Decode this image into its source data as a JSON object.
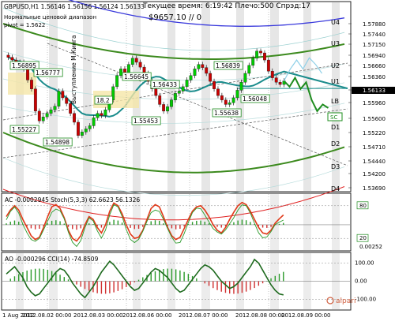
{
  "header": {
    "symbol_line": "GBPUSD,H1  1.56146 1.56156 1.56124 1.56133",
    "indicator_line1": "Нормальные ценовой диапазон",
    "indicator_line2": "pivot = 1.5622",
    "time_line": "Текущее время: 6:19:42  Плечо:500  Спрэд:17",
    "balance_line": "$9657.10   // 0"
  },
  "levels_left": [
    "U4",
    "U3",
    "U2",
    "U1",
    "LB",
    "D1",
    "D2",
    "D3",
    "D4"
  ],
  "price_axis_labels": [
    "1.57880",
    "1.57440",
    "1.57150",
    "1.56940",
    "1.56660",
    "1.56360",
    "1.56133",
    "1.55960",
    "1.55600",
    "1.55220",
    "1.54710",
    "1.54440",
    "1.54200",
    "1.53690"
  ],
  "price_tags": [
    "1.56895",
    "1.56777",
    "1.56645",
    "1.56433",
    "1.56839",
    "1.56048",
    "1.55453",
    "1.55638",
    "1.55227",
    "1.54898",
    "18.2"
  ],
  "vertical_label": "Выступление М.Кинга",
  "sc_label": "SC",
  "ac_panel": {
    "label": "AC -0.0002945  Stoch(5,3,3) 62.6623 56.1326",
    "axis": [
      "80",
      "20",
      "0.00252"
    ]
  },
  "ao_panel": {
    "label": "AO -0.000296  CCI(14) -74.8509",
    "axis": [
      "100.00",
      "0.00",
      "-100.00"
    ]
  },
  "time_axis": [
    "1 Aug 2012",
    "2012.08.02 00:00",
    "2012.08.03 00:00",
    "2012.08.06 00:00",
    "2012.08.07 00:00",
    "2012.08.08 00:00",
    "2012.08.09 00:00"
  ],
  "watermark": "alpari",
  "colors": {
    "up_candle": "#00cc00",
    "down_candle": "#cc0000",
    "ma_teal": "#1a8c8c",
    "channel_green": "#3c8a1e",
    "channel_blue": "#3a3adc",
    "channel_red": "#e02020",
    "forecast": "#1e8c1e",
    "stoch_red": "#e03a1a",
    "stoch_green": "#2a9a2a",
    "cci_green": "#1e6a1e"
  },
  "chart_data": {
    "type": "candlestick",
    "symbol": "GBPUSD",
    "timeframe": "H1",
    "y_range": [
      1.5369,
      1.5788
    ],
    "close_series": [
      1.5666,
      1.566,
      1.5648,
      1.5655,
      1.564,
      1.5615,
      1.5595,
      1.5545,
      1.5523,
      1.5532,
      1.554,
      1.5548,
      1.5556,
      1.559,
      1.5575,
      1.5562,
      1.554,
      1.552,
      1.549,
      1.5498,
      1.5505,
      1.5512,
      1.553,
      1.554,
      1.5535,
      1.5548,
      1.557,
      1.56,
      1.5625,
      1.564,
      1.563,
      1.565,
      1.5664,
      1.5655,
      1.5644,
      1.563,
      1.5612,
      1.5595,
      1.558,
      1.556,
      1.5545,
      1.5555,
      1.557,
      1.5585,
      1.559,
      1.56,
      1.5615,
      1.5625,
      1.564,
      1.565,
      1.5643,
      1.563,
      1.5612,
      1.5595,
      1.558,
      1.557,
      1.556,
      1.5564,
      1.5575,
      1.5592,
      1.561,
      1.563,
      1.5648,
      1.5664,
      1.568,
      1.5676,
      1.566,
      1.5635,
      1.562,
      1.561,
      1.5605,
      1.5613
    ],
    "forecast_path": [
      1.5613,
      1.56,
      1.562,
      1.5595,
      1.561,
      1.557,
      1.5545,
      1.556,
      1.5552
    ],
    "stoch": [
      60,
      72,
      80,
      72,
      55,
      40,
      25,
      18,
      22,
      40,
      60,
      78,
      82,
      75,
      58,
      35,
      20,
      15,
      25,
      45,
      60,
      55,
      40,
      30,
      45,
      70,
      85,
      80,
      65,
      45,
      28,
      20,
      22,
      35,
      55,
      75,
      82,
      78,
      60,
      40,
      25,
      18,
      22,
      38,
      55,
      70,
      78,
      80,
      72,
      60,
      45,
      35,
      30,
      40,
      55,
      68,
      80,
      86,
      82,
      70,
      55,
      40,
      30,
      28,
      35,
      48,
      56,
      63
    ],
    "cci": [
      40,
      60,
      80,
      50,
      20,
      -30,
      -60,
      -80,
      -70,
      -40,
      -10,
      20,
      50,
      70,
      60,
      30,
      -10,
      -40,
      -70,
      -90,
      -60,
      -30,
      10,
      50,
      80,
      110,
      90,
      60,
      30,
      0,
      -30,
      -50,
      -40,
      -10,
      20,
      50,
      70,
      60,
      40,
      20,
      -10,
      -40,
      -60,
      -50,
      -20,
      10,
      40,
      70,
      90,
      80,
      60,
      30,
      0,
      -20,
      -40,
      -30,
      -10,
      20,
      50,
      80,
      120,
      100,
      60,
      20,
      -20,
      -50,
      -70,
      -75
    ]
  }
}
